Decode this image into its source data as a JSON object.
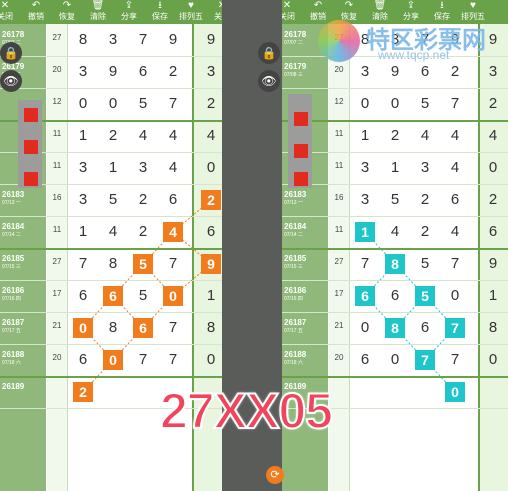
{
  "toolbar": {
    "left_buttons": [
      "关闭",
      "撤销",
      "恢复",
      "清除",
      "分享",
      "保存",
      "排列五",
      "关闭"
    ],
    "right_buttons": [
      "关闭",
      "撤销",
      "恢复",
      "清除",
      "分享",
      "保存",
      "排列五"
    ],
    "icons": [
      "close-icon",
      "undo-icon",
      "redo-icon",
      "trash-icon",
      "share-icon",
      "download-icon",
      "heart-icon",
      "close-icon"
    ]
  },
  "rows": [
    {
      "issue": "26178",
      "date": "07/07 二",
      "idx": "27",
      "digits": [
        "8",
        "3",
        "7",
        "9",
        "9"
      ]
    },
    {
      "issue": "26179",
      "date": "07/08 三",
      "idx": "20",
      "digits": [
        "3",
        "9",
        "6",
        "2",
        "3"
      ]
    },
    {
      "issue": "",
      "date": "",
      "idx": "12",
      "digits": [
        "0",
        "0",
        "5",
        "7",
        "2"
      ]
    },
    {
      "issue": "",
      "date": "",
      "idx": "11",
      "digits": [
        "1",
        "2",
        "4",
        "4",
        "4"
      ]
    },
    {
      "issue": "",
      "date": "",
      "idx": "11",
      "digits": [
        "3",
        "1",
        "3",
        "4",
        "0"
      ]
    },
    {
      "issue": "26183",
      "date": "07/13 一",
      "idx": "16",
      "digits": [
        "3",
        "5",
        "2",
        "6",
        "2"
      ]
    },
    {
      "issue": "26184",
      "date": "07/14 二",
      "idx": "11",
      "digits": [
        "1",
        "4",
        "2",
        "4",
        "6"
      ]
    },
    {
      "issue": "26185",
      "date": "07/15 三",
      "idx": "27",
      "digits": [
        "7",
        "8",
        "5",
        "7",
        "9"
      ]
    },
    {
      "issue": "26186",
      "date": "07/16 四",
      "idx": "17",
      "digits": [
        "6",
        "6",
        "5",
        "0",
        "1"
      ]
    },
    {
      "issue": "26187",
      "date": "07/17 五",
      "idx": "21",
      "digits": [
        "0",
        "8",
        "6",
        "7",
        "8"
      ]
    },
    {
      "issue": "26188",
      "date": "07/18 六",
      "idx": "20",
      "digits": [
        "6",
        "0",
        "7",
        "7",
        "0"
      ]
    },
    {
      "issue": "26189",
      "date": "",
      "idx": "",
      "digits": [
        "",
        "",
        "",
        "",
        ""
      ]
    }
  ],
  "left_highlights": [
    {
      "row": 5,
      "col": 4,
      "value": "2"
    },
    {
      "row": 6,
      "col": 3,
      "value": "4"
    },
    {
      "row": 7,
      "col": 2,
      "value": "5"
    },
    {
      "row": 7,
      "col": 4,
      "value": "9"
    },
    {
      "row": 8,
      "col": 1,
      "value": "6"
    },
    {
      "row": 8,
      "col": 3,
      "value": "0"
    },
    {
      "row": 9,
      "col": 0,
      "value": "0"
    },
    {
      "row": 9,
      "col": 2,
      "value": "6"
    },
    {
      "row": 10,
      "col": 1,
      "value": "0"
    },
    {
      "row": 11,
      "col": 0,
      "value": "2"
    }
  ],
  "right_highlights": [
    {
      "row": 6,
      "col": 0,
      "value": "1"
    },
    {
      "row": 7,
      "col": 1,
      "value": "8"
    },
    {
      "row": 8,
      "col": 0,
      "value": "6"
    },
    {
      "row": 8,
      "col": 2,
      "value": "5"
    },
    {
      "row": 9,
      "col": 1,
      "value": "8"
    },
    {
      "row": 9,
      "col": 3,
      "value": "7"
    },
    {
      "row": 10,
      "col": 2,
      "value": "7"
    },
    {
      "row": 11,
      "col": 3,
      "value": "0"
    }
  ],
  "overlay_text": "27XX05",
  "watermark": {
    "title": "特区彩票网",
    "url": "www.tqcp.net"
  },
  "colors": {
    "toolbar": "#6aa24a",
    "orange": "#f07c1e",
    "cyan": "#1fc6c9",
    "overlay": "#f0455a"
  }
}
